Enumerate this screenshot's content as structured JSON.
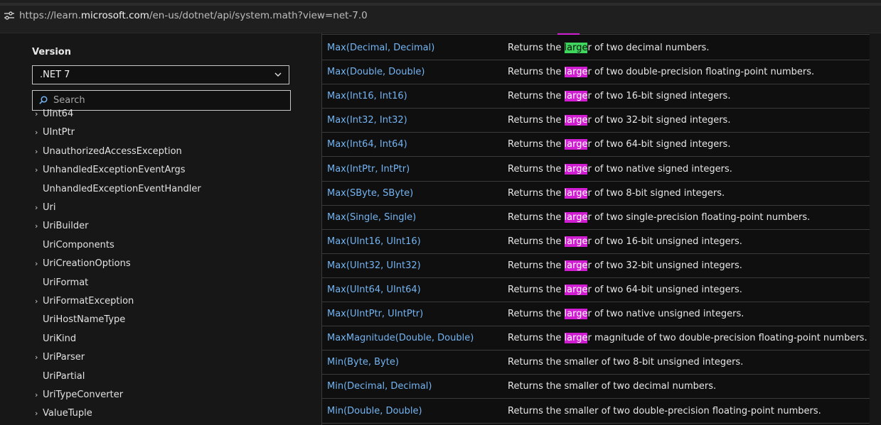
{
  "browser": {
    "url_prefix": "https://learn.",
    "url_host": "microsoft.com",
    "url_rest": "/en-us/dotnet/api/system.math?view=net-7.0",
    "site_info_icon": "tune-icon"
  },
  "sidebar": {
    "version_label": "Version",
    "version_value": ".NET 7",
    "search_placeholder": "Search",
    "items": [
      {
        "label": "UInt64",
        "expandable": true
      },
      {
        "label": "UIntPtr",
        "expandable": true
      },
      {
        "label": "UnauthorizedAccessException",
        "expandable": true
      },
      {
        "label": "UnhandledExceptionEventArgs",
        "expandable": true
      },
      {
        "label": "UnhandledExceptionEventHandler",
        "expandable": false
      },
      {
        "label": "Uri",
        "expandable": true
      },
      {
        "label": "UriBuilder",
        "expandable": true
      },
      {
        "label": "UriComponents",
        "expandable": false
      },
      {
        "label": "UriCreationOptions",
        "expandable": true
      },
      {
        "label": "UriFormat",
        "expandable": false
      },
      {
        "label": "UriFormatException",
        "expandable": true
      },
      {
        "label": "UriHostNameType",
        "expandable": false
      },
      {
        "label": "UriKind",
        "expandable": false
      },
      {
        "label": "UriParser",
        "expandable": true
      },
      {
        "label": "UriPartial",
        "expandable": false
      },
      {
        "label": "UriTypeConverter",
        "expandable": true
      },
      {
        "label": "ValueTuple",
        "expandable": true
      }
    ]
  },
  "search_highlight": "large",
  "table": {
    "rows": [
      {
        "method": "Max(Decimal, Decimal)",
        "pre": "Returns the ",
        "hl": "large",
        "post": "r of two decimal numbers.",
        "current": true
      },
      {
        "method": "Max(Double, Double)",
        "pre": "Returns the ",
        "hl": "large",
        "post": "r of two double-precision floating-point numbers."
      },
      {
        "method": "Max(Int16, Int16)",
        "pre": "Returns the ",
        "hl": "large",
        "post": "r of two 16-bit signed integers."
      },
      {
        "method": "Max(Int32, Int32)",
        "pre": "Returns the ",
        "hl": "large",
        "post": "r of two 32-bit signed integers."
      },
      {
        "method": "Max(Int64, Int64)",
        "pre": "Returns the ",
        "hl": "large",
        "post": "r of two 64-bit signed integers."
      },
      {
        "method": "Max(IntPtr, IntPtr)",
        "pre": "Returns the ",
        "hl": "large",
        "post": "r of two native signed integers."
      },
      {
        "method": "Max(SByte, SByte)",
        "pre": "Returns the ",
        "hl": "large",
        "post": "r of two 8-bit signed integers."
      },
      {
        "method": "Max(Single, Single)",
        "pre": "Returns the ",
        "hl": "large",
        "post": "r of two single-precision floating-point numbers."
      },
      {
        "method": "Max(UInt16, UInt16)",
        "pre": "Returns the ",
        "hl": "large",
        "post": "r of two 16-bit unsigned integers."
      },
      {
        "method": "Max(UInt32, UInt32)",
        "pre": "Returns the ",
        "hl": "large",
        "post": "r of two 32-bit unsigned integers."
      },
      {
        "method": "Max(UInt64, UInt64)",
        "pre": "Returns the ",
        "hl": "large",
        "post": "r of two 64-bit unsigned integers."
      },
      {
        "method": "Max(UIntPtr, UIntPtr)",
        "pre": "Returns the ",
        "hl": "large",
        "post": "r of two native unsigned integers."
      },
      {
        "method": "MaxMagnitude(Double, Double)",
        "pre": "Returns the ",
        "hl": "large",
        "post": "r magnitude of two double-precision floating-point numbers."
      },
      {
        "method": "Min(Byte, Byte)",
        "pre": "Returns the smaller of two 8-bit unsigned integers.",
        "hl": "",
        "post": ""
      },
      {
        "method": "Min(Decimal, Decimal)",
        "pre": "Returns the smaller of two decimal numbers.",
        "hl": "",
        "post": ""
      },
      {
        "method": "Min(Double, Double)",
        "pre": "Returns the smaller of two double-precision floating-point numbers.",
        "hl": "",
        "post": ""
      }
    ]
  },
  "colors": {
    "link": "#74b4f2",
    "match_highlight": "#d11dd1",
    "current_match_highlight": "#3ed65c",
    "background": "#171717"
  }
}
